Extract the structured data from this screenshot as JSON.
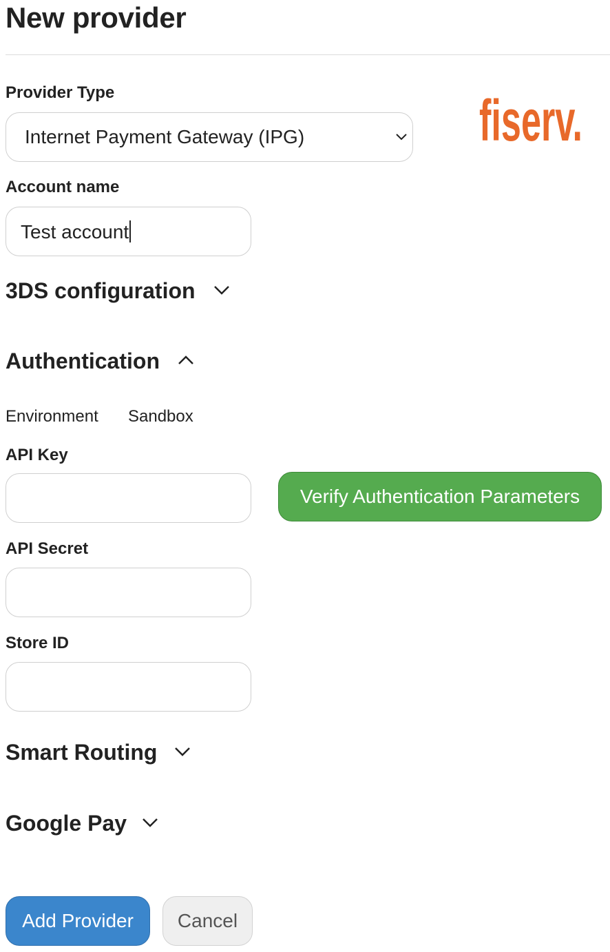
{
  "page": {
    "title": "New provider"
  },
  "provider_type": {
    "label": "Provider Type",
    "selected": "Internet Payment Gateway (IPG)"
  },
  "logo": {
    "text": "fiserv.",
    "color": "#e8692a"
  },
  "account": {
    "label": "Account name",
    "value": "Test account"
  },
  "sections": {
    "threeds": {
      "title": "3DS configuration",
      "state": "collapsed"
    },
    "authentication": {
      "title": "Authentication",
      "state": "expanded"
    },
    "smart_routing": {
      "title": "Smart Routing",
      "state": "collapsed"
    },
    "google_pay": {
      "title": "Google Pay",
      "state": "collapsed"
    }
  },
  "auth": {
    "environment_label": "Environment",
    "environment_value": "Sandbox",
    "api_key_label": "API Key",
    "api_key_value": "",
    "api_secret_label": "API Secret",
    "api_secret_value": "",
    "store_id_label": "Store ID",
    "store_id_value": "",
    "verify_button": "Verify Authentication Parameters"
  },
  "footer": {
    "add_button": "Add Provider",
    "cancel_button": "Cancel"
  },
  "colors": {
    "verify_button": "#55ab4f",
    "add_button": "#3b86cc",
    "cancel_button": "#efefef"
  }
}
